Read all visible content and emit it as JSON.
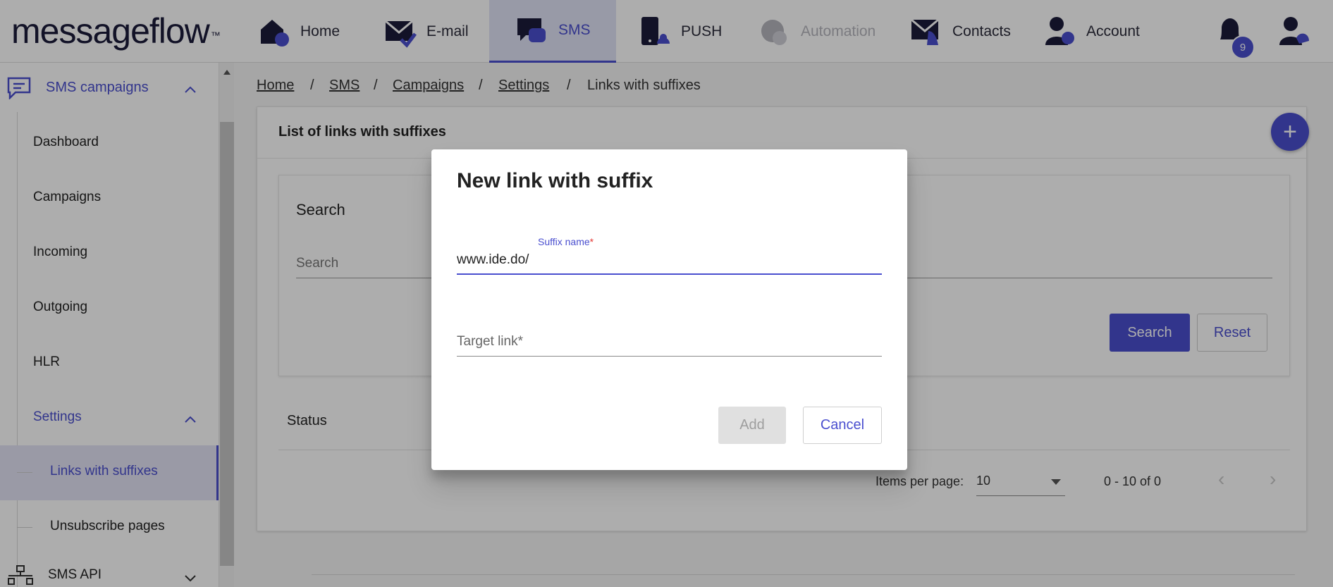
{
  "brand": {
    "logo_light": "messageflow",
    "logo_tm": "™"
  },
  "nav": {
    "home": "Home",
    "email": "E-mail",
    "sms": "SMS",
    "push": "PUSH",
    "automation": "Automation",
    "contacts": "Contacts",
    "account": "Account",
    "notifications_count": "9"
  },
  "sidebar": {
    "section": "SMS campaigns",
    "items": [
      "Dashboard",
      "Campaigns",
      "Incoming",
      "Outgoing",
      "HLR"
    ],
    "settings": "Settings",
    "settings_items": [
      "Links with suffixes",
      "Unsubscribe pages"
    ],
    "api": "SMS API"
  },
  "breadcrumb": [
    "Home",
    "SMS",
    "Campaigns",
    "Settings",
    "Links with suffixes"
  ],
  "breadcrumb_sep": "/",
  "card": {
    "title": "List of links with suffixes",
    "add_symbol": "+",
    "search_title": "Search",
    "search_placeholder": "Search",
    "search_button": "Search",
    "reset_button": "Reset",
    "status_label": "Status",
    "items_per_page_label": "Items per page:",
    "items_per_page_value": "10",
    "range": "0 - 10 of 0",
    "prev": "‹",
    "next": "›"
  },
  "dialog": {
    "title": "New link with suffix",
    "suffix_label": "Suffix name",
    "required_mark": "*",
    "suffix_value": "www.ide.do/",
    "target_placeholder": "Target link*",
    "add_button": "Add",
    "cancel_button": "Cancel"
  },
  "colors": {
    "accent": "#4a4fcf",
    "icon_dark": "#1b1b3a",
    "required": "#e53935"
  }
}
